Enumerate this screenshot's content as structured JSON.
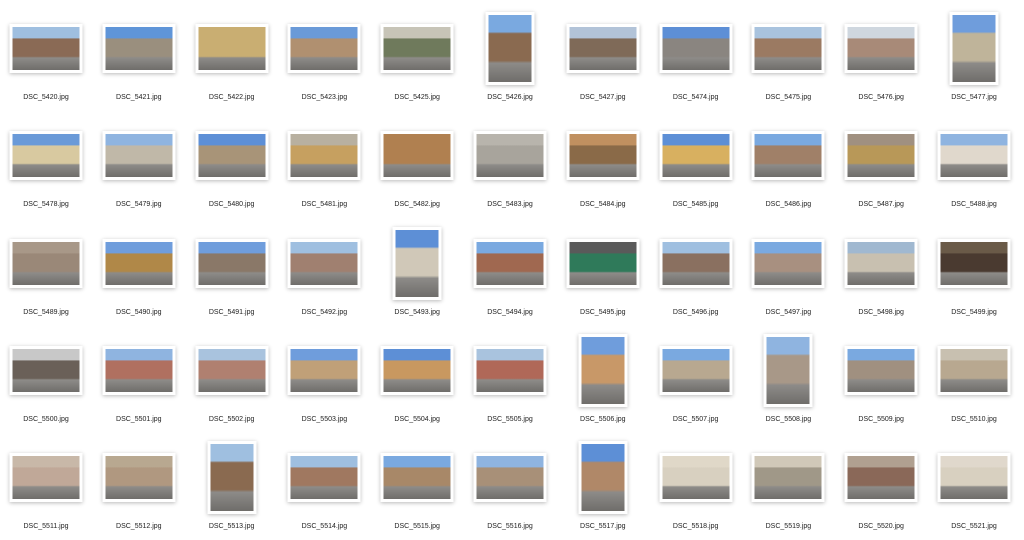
{
  "files": [
    {
      "name": "DSC_5420.jpg",
      "orientation": "landscape",
      "wall": "#8a6a55",
      "sky": "#9fbfe0"
    },
    {
      "name": "DSC_5421.jpg",
      "orientation": "landscape",
      "wall": "#9a8f7e",
      "sky": "#5f95d8"
    },
    {
      "name": "DSC_5422.jpg",
      "orientation": "landscape",
      "wall": "#c9ae72",
      "sky": "#c9ae72"
    },
    {
      "name": "DSC_5423.jpg",
      "orientation": "landscape",
      "wall": "#b09070",
      "sky": "#6a9ad8"
    },
    {
      "name": "DSC_5425.jpg",
      "orientation": "landscape",
      "wall": "#6f7a5c",
      "sky": "#c7c4b7"
    },
    {
      "name": "DSC_5426.jpg",
      "orientation": "portrait",
      "wall": "#8a6a50",
      "sky": "#7aa9e0"
    },
    {
      "name": "DSC_5427.jpg",
      "orientation": "landscape",
      "wall": "#7f6a58",
      "sky": "#b2c3d8"
    },
    {
      "name": "DSC_5474.jpg",
      "orientation": "landscape",
      "wall": "#8a8580",
      "sky": "#5d8fd6"
    },
    {
      "name": "DSC_5475.jpg",
      "orientation": "landscape",
      "wall": "#9b7a62",
      "sky": "#a9c3de"
    },
    {
      "name": "DSC_5476.jpg",
      "orientation": "landscape",
      "wall": "#a88a78",
      "sky": "#cfd7df"
    },
    {
      "name": "DSC_5477.jpg",
      "orientation": "portrait",
      "wall": "#bfb49a",
      "sky": "#6f9ddc"
    },
    {
      "name": "DSC_5478.jpg",
      "orientation": "landscape",
      "wall": "#d8c9a0",
      "sky": "#6a9ad8"
    },
    {
      "name": "DSC_5479.jpg",
      "orientation": "landscape",
      "wall": "#c0b8a8",
      "sky": "#8fb4e0"
    },
    {
      "name": "DSC_5480.jpg",
      "orientation": "landscape",
      "wall": "#a89478",
      "sky": "#5d8fd6"
    },
    {
      "name": "DSC_5481.jpg",
      "orientation": "landscape",
      "wall": "#c6a060",
      "sky": "#b8b0a0"
    },
    {
      "name": "DSC_5482.jpg",
      "orientation": "landscape",
      "wall": "#b08050",
      "sky": "#b08050"
    },
    {
      "name": "DSC_5483.jpg",
      "orientation": "landscape",
      "wall": "#a8a49c",
      "sky": "#b8b4ac"
    },
    {
      "name": "DSC_5484.jpg",
      "orientation": "landscape",
      "wall": "#8a6a48",
      "sky": "#c09060"
    },
    {
      "name": "DSC_5485.jpg",
      "orientation": "landscape",
      "wall": "#d8b060",
      "sky": "#5d8fd6"
    },
    {
      "name": "DSC_5486.jpg",
      "orientation": "landscape",
      "wall": "#a08068",
      "sky": "#7aa9e0"
    },
    {
      "name": "DSC_5487.jpg",
      "orientation": "landscape",
      "wall": "#b89858",
      "sky": "#a09080"
    },
    {
      "name": "DSC_5488.jpg",
      "orientation": "landscape",
      "wall": "#e0d8cc",
      "sky": "#8fb4e0"
    },
    {
      "name": "DSC_5489.jpg",
      "orientation": "landscape",
      "wall": "#9a8878",
      "sky": "#a89888"
    },
    {
      "name": "DSC_5490.jpg",
      "orientation": "landscape",
      "wall": "#b08848",
      "sky": "#6f9ddc"
    },
    {
      "name": "DSC_5491.jpg",
      "orientation": "landscape",
      "wall": "#8a7868",
      "sky": "#6f9ddc"
    },
    {
      "name": "DSC_5492.jpg",
      "orientation": "landscape",
      "wall": "#a08070",
      "sky": "#9fbfe0"
    },
    {
      "name": "DSC_5493.jpg",
      "orientation": "portrait",
      "wall": "#d0c8b8",
      "sky": "#5d8fd6"
    },
    {
      "name": "DSC_5494.jpg",
      "orientation": "landscape",
      "wall": "#a06850",
      "sky": "#7aa9e0"
    },
    {
      "name": "DSC_5495.jpg",
      "orientation": "landscape",
      "wall": "#2f7a5a",
      "sky": "#5a5a5a"
    },
    {
      "name": "DSC_5496.jpg",
      "orientation": "landscape",
      "wall": "#8a7060",
      "sky": "#9fbfe0"
    },
    {
      "name": "DSC_5497.jpg",
      "orientation": "landscape",
      "wall": "#a89080",
      "sky": "#7aa9e0"
    },
    {
      "name": "DSC_5498.jpg",
      "orientation": "landscape",
      "wall": "#c8c0b0",
      "sky": "#a0b8d0"
    },
    {
      "name": "DSC_5499.jpg",
      "orientation": "landscape",
      "wall": "#4a3a30",
      "sky": "#6a5a48"
    },
    {
      "name": "DSC_5500.jpg",
      "orientation": "landscape",
      "wall": "#6a6058",
      "sky": "#c8c8c8"
    },
    {
      "name": "DSC_5501.jpg",
      "orientation": "landscape",
      "wall": "#b07060",
      "sky": "#8fb4e0"
    },
    {
      "name": "DSC_5502.jpg",
      "orientation": "landscape",
      "wall": "#b08070",
      "sky": "#a9c3de"
    },
    {
      "name": "DSC_5503.jpg",
      "orientation": "landscape",
      "wall": "#c0a078",
      "sky": "#6f9ddc"
    },
    {
      "name": "DSC_5504.jpg",
      "orientation": "landscape",
      "wall": "#c89860",
      "sky": "#5d8fd6"
    },
    {
      "name": "DSC_5505.jpg",
      "orientation": "landscape",
      "wall": "#b06858",
      "sky": "#a9c3de"
    },
    {
      "name": "DSC_5506.jpg",
      "orientation": "portrait",
      "wall": "#c89868",
      "sky": "#6f9ddc"
    },
    {
      "name": "DSC_5507.jpg",
      "orientation": "landscape",
      "wall": "#b8a890",
      "sky": "#7aa9e0"
    },
    {
      "name": "DSC_5508.jpg",
      "orientation": "portrait",
      "wall": "#a89888",
      "sky": "#8fb4e0"
    },
    {
      "name": "DSC_5509.jpg",
      "orientation": "landscape",
      "wall": "#a09080",
      "sky": "#7aa9e0"
    },
    {
      "name": "DSC_5510.jpg",
      "orientation": "landscape",
      "wall": "#b8a890",
      "sky": "#c8c0b0"
    },
    {
      "name": "DSC_5511.jpg",
      "orientation": "landscape",
      "wall": "#c0a898",
      "sky": "#c8b8a8"
    },
    {
      "name": "DSC_5512.jpg",
      "orientation": "landscape",
      "wall": "#b09880",
      "sky": "#b8a890"
    },
    {
      "name": "DSC_5513.jpg",
      "orientation": "portrait",
      "wall": "#8a6a50",
      "sky": "#9fbfe0"
    },
    {
      "name": "DSC_5514.jpg",
      "orientation": "landscape",
      "wall": "#a07860",
      "sky": "#9fbfe0"
    },
    {
      "name": "DSC_5515.jpg",
      "orientation": "landscape",
      "wall": "#a88868",
      "sky": "#7aa9e0"
    },
    {
      "name": "DSC_5516.jpg",
      "orientation": "landscape",
      "wall": "#a89078",
      "sky": "#8fb4e0"
    },
    {
      "name": "DSC_5517.jpg",
      "orientation": "portrait",
      "wall": "#b08868",
      "sky": "#5d8fd6"
    },
    {
      "name": "DSC_5518.jpg",
      "orientation": "landscape",
      "wall": "#d8d0c0",
      "sky": "#e0d8c8"
    },
    {
      "name": "DSC_5519.jpg",
      "orientation": "landscape",
      "wall": "#a09888",
      "sky": "#d0c8b8"
    },
    {
      "name": "DSC_5520.jpg",
      "orientation": "landscape",
      "wall": "#8a6858",
      "sky": "#b0a090"
    },
    {
      "name": "DSC_5521.jpg",
      "orientation": "landscape",
      "wall": "#d8d0c0",
      "sky": "#e0d8cc"
    }
  ]
}
